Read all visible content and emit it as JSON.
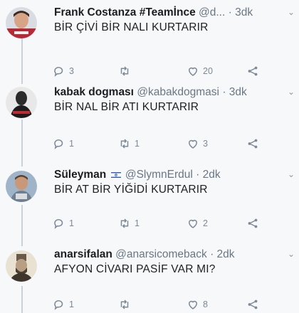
{
  "tweets": [
    {
      "name": "Frank Costanza #Teamİnce",
      "handle": "@d...",
      "time": "· 3dk",
      "text": "BİR ÇİVİ BİR NALI KURTARIR",
      "replies": "3",
      "retweets": "",
      "likes": "20",
      "avatar_icon": "child-photo-avatar-icon"
    },
    {
      "name": "kabak dogması",
      "handle": "@kabakdogmasi",
      "time": "· 3dk",
      "text": "BİR NAL BİR ATI KURTARIR",
      "replies": "1",
      "retweets": "1",
      "likes": "3",
      "avatar_icon": "portrait-photo-avatar-icon"
    },
    {
      "name": "Süleyman",
      "handle": "@SlymnErdul",
      "time": "· 2dk",
      "text": "BİR AT BİR YİĞİDİ KURTARIR",
      "replies": "1",
      "retweets": "1",
      "likes": "2",
      "avatar_icon": "kid-photo-avatar-icon"
    },
    {
      "name": "anarsifalan",
      "handle": "@anarsicomeback",
      "time": "· 2dk",
      "text": "AFYON CİVARI PASİF VAR MI?",
      "replies": "1",
      "retweets": "",
      "likes": "8",
      "avatar_icon": "fez-portrait-avatar-icon"
    }
  ],
  "colors": {
    "background": "#f7f8f9",
    "name": "#1a1d21",
    "handle": "#697784",
    "icon": "#7c8a98",
    "thread_line": "#c9d2da"
  }
}
